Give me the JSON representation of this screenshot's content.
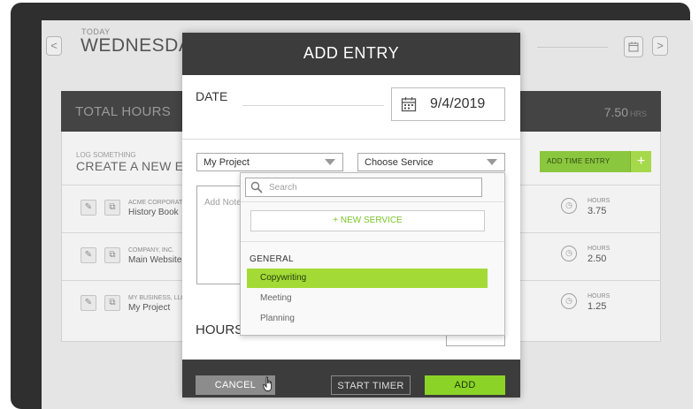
{
  "header": {
    "today_label": "TODAY",
    "day_title": "WEDNESDAY,",
    "prev_glyph": "<",
    "next_glyph": ">"
  },
  "total": {
    "label": "TOTAL HOURS",
    "value": "7.50",
    "unit": "HRS"
  },
  "log": {
    "small": "LOG SOMETHING",
    "big": "CREATE A NEW EN",
    "add_time_label": "ADD TIME ENTRY",
    "add_time_plus": "+"
  },
  "entries": [
    {
      "company": "ACME CORPORATI",
      "project": "History Book",
      "hours_label": "HOURS",
      "hours": "3.75"
    },
    {
      "company": "COMPANY, INC.",
      "project": "Main Website",
      "hours_label": "HOURS",
      "hours": "2.50"
    },
    {
      "company": "MY BUSINESS, LLC",
      "project": "My Project",
      "hours_label": "HOURS",
      "hours": "1.25"
    }
  ],
  "modal": {
    "title": "ADD ENTRY",
    "date_label": "DATE",
    "date_value": "9/4/2019",
    "project_select": "My Project",
    "service_select": "Choose Service",
    "notes_placeholder": "Add Note",
    "hours_label": "HOURS",
    "cancel": "CANCEL",
    "start_timer": "START TIMER",
    "add": "ADD"
  },
  "dropdown": {
    "search_placeholder": "Search",
    "new_service": "+ NEW SERVICE",
    "group": "GENERAL",
    "items": [
      "Copywriting",
      "Meeting",
      "Planning"
    ],
    "selected_index": 0
  },
  "colors": {
    "accent_green": "#8bd427",
    "selected_green": "#a3da36",
    "dark": "#3c3c3c"
  }
}
